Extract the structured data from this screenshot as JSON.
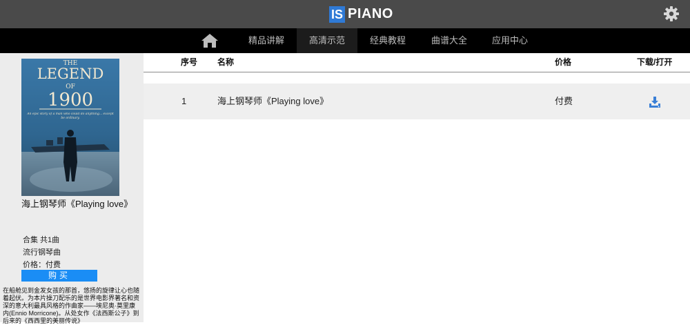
{
  "header": {
    "logo_box": "IS",
    "logo_text": "PIANO"
  },
  "nav": {
    "home_icon": "home-icon",
    "items": [
      {
        "label": "精品讲解"
      },
      {
        "label": "高清示范"
      },
      {
        "label": "经典教程"
      },
      {
        "label": "曲谱大全"
      },
      {
        "label": "应用中心"
      }
    ],
    "active_index": 1
  },
  "sidebar": {
    "cover": {
      "the": "THE",
      "legend": "LEGEND",
      "of": "OF",
      "year": "1900",
      "tagline": "An epic story of a man who could do anything... except be ordinary."
    },
    "album_title": "海上钢琴师《Playing love》",
    "collection": "合集  共1曲",
    "genre": "流行钢琴曲",
    "price": "价格：付费",
    "buy_label": "购买",
    "description": "在船舱见到金发女孩的那首，悠扬的旋律让心也随着起伏。为本片操刀配乐的是世界电影界著名和资深的意大利最具风格的作曲家——埃尼奥·莫里康内(Ennio Morricone)。从处女作《法西斯公子》到后来的《西西里的美丽传说》"
  },
  "table": {
    "headers": {
      "index": "序号",
      "name": "名称",
      "price": "价格",
      "download": "下载/打开"
    },
    "rows": [
      {
        "index": "1",
        "name": "海上钢琴师《Playing love》",
        "price": "付费",
        "action_icon": "download-icon"
      }
    ]
  },
  "colors": {
    "topbar": "#4a4a4a",
    "navbar": "#000000",
    "accent": "#1a8df5",
    "logo_blue": "#2f7ad6",
    "sidebar_bg": "#ececec",
    "row_bg": "#efefef"
  }
}
